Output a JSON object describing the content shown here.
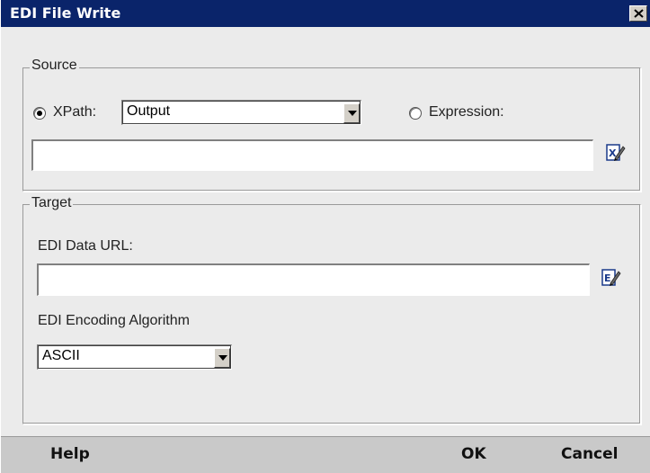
{
  "window": {
    "title": "EDI File Write"
  },
  "source": {
    "group_label": "Source",
    "xpath_label": "XPath:",
    "xpath_selected": true,
    "xpath_value": "Output",
    "expression_label": "Expression:",
    "expression_selected": false,
    "expression_value": ""
  },
  "target": {
    "group_label": "Target",
    "url_label": "EDI Data URL:",
    "url_value": "",
    "encoding_label": "EDI Encoding Algorithm",
    "encoding_value": "ASCII"
  },
  "footer": {
    "help_label": "Help",
    "ok_label": "OK",
    "cancel_label": "Cancel"
  },
  "icons": {
    "close": "close-icon",
    "xpath_editor": "xpath-editor-icon",
    "expression_editor": "expression-editor-icon"
  }
}
